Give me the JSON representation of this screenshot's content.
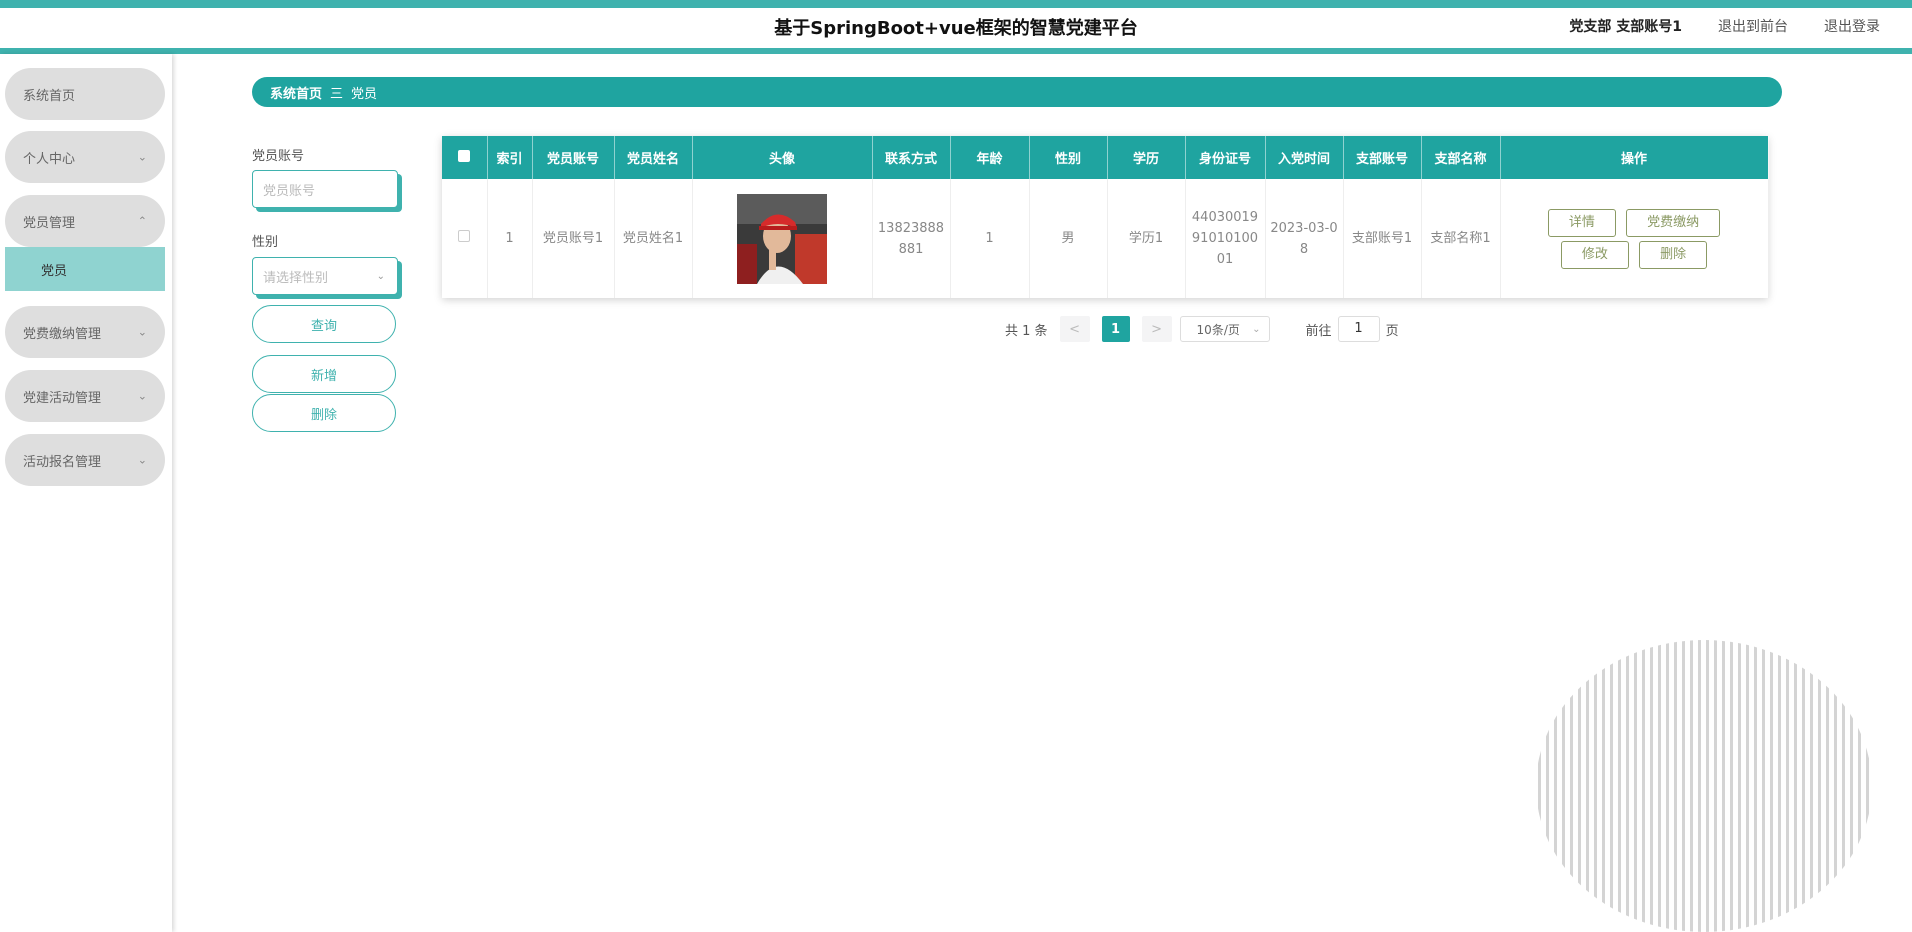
{
  "header": {
    "title": "基于SpringBoot+vue框架的智慧党建平台",
    "user": "党支部 支部账号1",
    "to_front": "退出到前台",
    "logout": "退出登录"
  },
  "sidebar": {
    "items": [
      {
        "label": "系统首页"
      },
      {
        "label": "个人中心"
      },
      {
        "label": "党员管理"
      },
      {
        "label": "党员"
      },
      {
        "label": "党费缴纳管理"
      },
      {
        "label": "党建活动管理"
      },
      {
        "label": "活动报名管理"
      }
    ]
  },
  "breadcrumb": {
    "home": "系统首页",
    "sep": "三",
    "current": "党员"
  },
  "search": {
    "account_label": "党员账号",
    "account_placeholder": "党员账号",
    "gender_label": "性别",
    "gender_placeholder": "请选择性别",
    "query": "查询",
    "add": "新增",
    "delete": "删除"
  },
  "table": {
    "headers": [
      "索引",
      "党员账号",
      "党员姓名",
      "头像",
      "联系方式",
      "年龄",
      "性别",
      "学历",
      "身份证号",
      "入党时间",
      "支部账号",
      "支部名称",
      "操作"
    ],
    "rows": [
      {
        "index": "1",
        "account": "党员账号1",
        "name": "党员姓名1",
        "phone": "13823888881",
        "age": "1",
        "gender": "男",
        "education": "学历1",
        "id_card": "440300199101010001",
        "join_date": "2023-03-08",
        "branch_account": "支部账号1",
        "branch_name": "支部名称1"
      }
    ],
    "actions": {
      "detail": "详情",
      "pay": "党费缴纳",
      "edit": "修改",
      "delete": "删除"
    }
  },
  "pagination": {
    "total": "共 1 条",
    "prev": "<",
    "current": "1",
    "next": ">",
    "page_size": "10条/页",
    "goto_label": "前往",
    "goto_value": "1",
    "page_unit": "页"
  },
  "colors": {
    "accent": "#1fa4a0",
    "accent_light": "#3fb2ae",
    "submenu_active": "#8fd3d0"
  }
}
